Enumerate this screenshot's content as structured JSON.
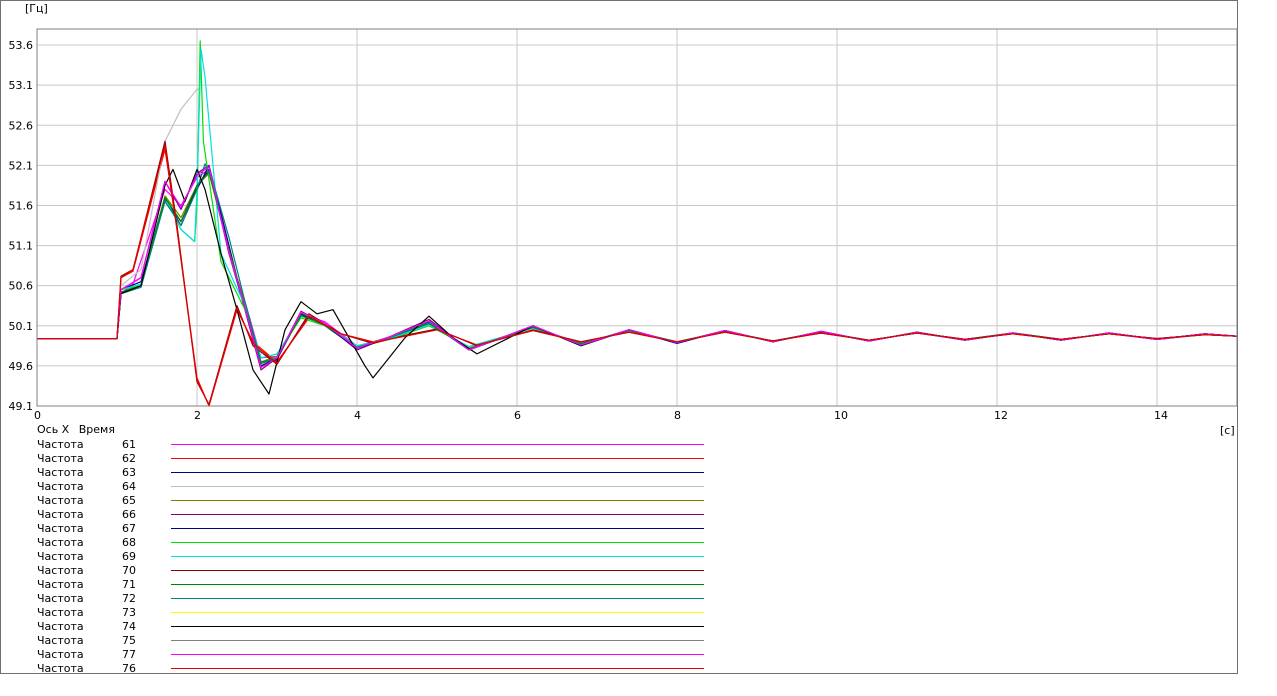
{
  "chart_data": {
    "type": "line",
    "ylabel": "[Гц]",
    "xlabel": "[с]",
    "xlim": [
      0,
      15
    ],
    "ylim": [
      49.1,
      53.8
    ],
    "xticks": [
      0,
      2,
      4,
      6,
      8,
      10,
      12,
      14
    ],
    "xtick_labels": [
      "0",
      "2",
      "4",
      "6",
      "8",
      "10",
      "12",
      "14"
    ],
    "yticks": [
      49.1,
      49.6,
      50.1,
      50.6,
      51.1,
      51.6,
      52.1,
      52.6,
      53.1,
      53.6
    ],
    "ytick_labels": [
      "49.1",
      "49.6",
      "50.1",
      "50.6",
      "51.1",
      "51.6",
      "52.1",
      "52.6",
      "53.1",
      "53.6"
    ],
    "grid": true,
    "legend_position": "bottom-left",
    "legend_header": [
      "Ось X",
      "Время"
    ],
    "series": [
      {
        "name": "Частота",
        "id": "61",
        "color": "#ff00ff",
        "x": [
          0,
          1,
          1.05,
          1.2,
          1.6,
          1.8,
          2.0,
          2.15,
          2.4,
          2.6,
          2.8,
          3.0,
          3.3,
          3.6,
          4.0,
          4.4,
          4.9,
          5.4,
          6.2,
          6.8,
          7.4,
          8.0,
          8.6,
          9.2,
          9.8,
          10.4,
          11.0,
          11.6,
          12.2,
          12.8,
          13.4,
          14.0,
          14.6,
          15
        ],
        "y": [
          49.94,
          49.94,
          50.5,
          50.62,
          51.8,
          51.6,
          51.95,
          52.05,
          51.0,
          50.4,
          49.7,
          49.72,
          50.25,
          50.15,
          49.85,
          49.95,
          50.12,
          49.82,
          50.08,
          49.88,
          50.04,
          49.9,
          50.03,
          49.91,
          50.02,
          49.92,
          50.01,
          49.92,
          50.01,
          49.93,
          50.0,
          49.93,
          49.99,
          49.97
        ]
      },
      {
        "name": "Частота",
        "id": "62",
        "color": "#ff0000",
        "x": [
          0,
          1,
          1.05,
          1.2,
          1.6,
          1.75,
          2.0,
          2.15,
          2.5,
          2.7,
          3.0,
          3.4,
          3.8,
          4.2,
          4.6,
          5.0,
          5.5,
          6.2,
          6.8,
          7.4,
          8.0,
          8.6,
          9.2,
          9.8,
          10.4,
          11.0,
          11.6,
          12.2,
          12.8,
          13.4,
          14.0,
          14.6,
          15
        ],
        "y": [
          49.94,
          49.94,
          50.7,
          50.78,
          52.3,
          51.3,
          49.45,
          49.1,
          50.3,
          49.9,
          49.65,
          50.2,
          50.0,
          49.9,
          49.97,
          50.05,
          49.86,
          50.04,
          49.9,
          50.02,
          49.9,
          50.02,
          49.91,
          50.01,
          49.92,
          50.01,
          49.93,
          50.0,
          49.93,
          50.0,
          49.94,
          49.99,
          49.97
        ]
      },
      {
        "name": "Частота",
        "id": "63",
        "color": "#00008b",
        "x": [
          0,
          1,
          1.05,
          1.3,
          1.6,
          1.8,
          2.0,
          2.15,
          2.4,
          2.6,
          2.8,
          3.0,
          3.3,
          3.6,
          4.0,
          4.4,
          4.9,
          5.4,
          6.2,
          6.8,
          7.4,
          8.0,
          8.6,
          9.2,
          9.8,
          10.4,
          11.0,
          11.6,
          12.2,
          12.8,
          13.4,
          14.0,
          14.6,
          15
        ],
        "y": [
          49.94,
          49.94,
          50.55,
          50.65,
          51.7,
          51.35,
          51.8,
          52.1,
          51.1,
          50.3,
          49.6,
          49.7,
          50.25,
          50.1,
          49.82,
          49.95,
          50.15,
          49.8,
          50.1,
          49.86,
          50.05,
          49.88,
          50.04,
          49.9,
          50.03,
          49.91,
          50.02,
          49.92,
          50.01,
          49.92,
          50.01,
          49.93,
          50.0,
          49.97
        ]
      },
      {
        "name": "Частота",
        "id": "64",
        "color": "#c0c0c0",
        "x": [
          0,
          1,
          1.05,
          1.3,
          1.6,
          1.8,
          2.0,
          2.03
        ],
        "y": [
          49.94,
          49.94,
          50.6,
          50.8,
          52.4,
          52.8,
          53.05,
          53.05
        ]
      },
      {
        "name": "Частота",
        "id": "65",
        "color": "#808000",
        "x": [
          0,
          1,
          1.05,
          1.3,
          1.6,
          1.8,
          2.0,
          2.15,
          2.4,
          2.6,
          2.8,
          3.0,
          3.3,
          3.6,
          4.0,
          4.4,
          4.9,
          5.4,
          6.2,
          6.8,
          7.4,
          8.0,
          8.6,
          9.2,
          9.8,
          10.4,
          11.0,
          11.6,
          12.2,
          12.8,
          13.4,
          14.0,
          14.6,
          15
        ],
        "y": [
          49.94,
          49.94,
          50.52,
          50.6,
          51.72,
          51.45,
          51.85,
          52.0,
          51.05,
          50.35,
          49.65,
          49.72,
          50.22,
          50.12,
          49.84,
          49.96,
          50.12,
          49.82,
          50.08,
          49.88,
          50.04,
          49.9,
          50.03,
          49.91,
          50.02,
          49.92,
          50.01,
          49.93,
          50.01,
          49.93,
          50.0,
          49.94,
          49.99,
          49.97
        ]
      },
      {
        "name": "Частота",
        "id": "66",
        "color": "#800080",
        "x": [
          0,
          1,
          1.05,
          1.3,
          1.6,
          1.8,
          2.0,
          2.15,
          2.4,
          2.6,
          2.8,
          3.0,
          3.3,
          3.6,
          4.0,
          4.4,
          4.9,
          5.4,
          6.2,
          6.8,
          7.4,
          8.0,
          8.6,
          9.2,
          9.8,
          10.4,
          11.0,
          11.6,
          12.2,
          12.8,
          13.4,
          14.0,
          14.6,
          15
        ],
        "y": [
          49.94,
          49.94,
          50.55,
          50.7,
          51.9,
          51.55,
          52.0,
          52.1,
          51.0,
          50.3,
          49.55,
          49.7,
          50.28,
          50.12,
          49.8,
          49.96,
          50.18,
          49.8,
          50.1,
          49.86,
          50.05,
          49.89,
          50.04,
          49.9,
          50.03,
          49.91,
          50.02,
          49.92,
          50.01,
          49.92,
          50.01,
          49.93,
          50.0,
          49.97
        ]
      },
      {
        "name": "Частота",
        "id": "67",
        "color": "#000080",
        "x": [
          0,
          1,
          1.05,
          1.3,
          1.6,
          1.8,
          2.0,
          2.15,
          2.4,
          2.6,
          2.8,
          3.0,
          3.3,
          3.6,
          4.0,
          4.4,
          4.9,
          5.4,
          6.2,
          6.8,
          7.4,
          8.0,
          8.6,
          9.2,
          9.8,
          10.4,
          11.0,
          11.6,
          12.2,
          12.8,
          13.4,
          14.0,
          14.6,
          15
        ],
        "y": [
          49.94,
          49.94,
          50.5,
          50.6,
          51.68,
          51.4,
          51.82,
          52.05,
          51.05,
          50.3,
          49.6,
          49.68,
          50.25,
          50.1,
          49.82,
          49.94,
          50.14,
          49.8,
          50.09,
          49.87,
          50.05,
          49.89,
          50.04,
          49.9,
          50.03,
          49.91,
          50.02,
          49.92,
          50.01,
          49.92,
          50.01,
          49.93,
          50.0,
          49.97
        ]
      },
      {
        "name": "Частота",
        "id": "68",
        "color": "#00e000",
        "x": [
          0,
          1,
          1.05,
          1.3,
          1.6,
          1.8,
          1.97,
          2.0,
          2.04,
          2.08,
          2.3,
          2.6,
          2.8,
          3.0,
          3.3,
          3.6,
          4.0,
          4.4,
          4.9,
          5.4,
          6.2,
          6.8,
          7.4,
          8.0,
          8.6,
          9.2,
          9.8,
          10.4,
          11.0,
          11.6,
          12.2,
          12.8,
          13.4,
          14.0,
          14.6,
          15
        ],
        "y": [
          49.94,
          49.94,
          50.55,
          50.6,
          51.7,
          51.3,
          51.15,
          51.6,
          53.65,
          52.4,
          50.9,
          50.3,
          49.7,
          49.75,
          50.2,
          50.1,
          49.85,
          49.93,
          50.1,
          49.84,
          50.07,
          49.88,
          50.04,
          49.9,
          50.03,
          49.91,
          50.02,
          49.92,
          50.01,
          49.93,
          50.01,
          49.93,
          50.0,
          49.94,
          49.99,
          49.97
        ]
      },
      {
        "name": "Частота",
        "id": "69",
        "color": "#00e0e0",
        "x": [
          0,
          1,
          1.05,
          1.3,
          1.6,
          1.8,
          1.97,
          2.0,
          2.05,
          2.1,
          2.3,
          2.6,
          2.8,
          3.0,
          3.3,
          3.6,
          4.0,
          4.4,
          4.9,
          5.4,
          6.2,
          6.8,
          7.4,
          8.0,
          8.6,
          9.2,
          9.8,
          10.4,
          11.0,
          11.6,
          12.2,
          12.8,
          13.4,
          14.0,
          14.6,
          15
        ],
        "y": [
          49.94,
          49.94,
          50.55,
          50.62,
          51.7,
          51.3,
          51.15,
          51.8,
          53.55,
          53.2,
          51.0,
          50.35,
          49.7,
          49.75,
          50.22,
          50.12,
          49.85,
          49.94,
          50.11,
          49.84,
          50.07,
          49.88,
          50.04,
          49.9,
          50.03,
          49.91,
          50.02,
          49.92,
          50.01,
          49.93,
          50.01,
          49.93,
          50.0,
          49.94,
          49.99,
          49.97
        ]
      },
      {
        "name": "Частота",
        "id": "70",
        "color": "#8b0000",
        "x": [
          0,
          1,
          1.05,
          1.2,
          1.6,
          1.75,
          2.0,
          2.15,
          2.5,
          2.7,
          3.0,
          3.4,
          3.8,
          4.2,
          4.6,
          5.0,
          5.5,
          6.2,
          6.8,
          7.4,
          8.0,
          8.6,
          9.2,
          9.8,
          10.4,
          11.0,
          11.6,
          12.2,
          12.8,
          13.4,
          14.0,
          14.6,
          15
        ],
        "y": [
          49.94,
          49.94,
          50.72,
          50.8,
          52.4,
          51.35,
          49.4,
          49.12,
          50.35,
          49.85,
          49.62,
          50.25,
          50.0,
          49.88,
          49.98,
          50.06,
          49.85,
          50.05,
          49.9,
          50.02,
          49.9,
          50.02,
          49.91,
          50.01,
          49.92,
          50.01,
          49.93,
          50.0,
          49.93,
          50.0,
          49.94,
          49.99,
          49.97
        ]
      },
      {
        "name": "Частота",
        "id": "71",
        "color": "#008000",
        "x": [
          0,
          1,
          1.05,
          1.3,
          1.6,
          1.8,
          2.0,
          2.15,
          2.4,
          2.6,
          2.8,
          3.0,
          3.3,
          3.6,
          4.0,
          4.4,
          4.9,
          5.4,
          6.2,
          6.8,
          7.4,
          8.0,
          8.6,
          9.2,
          9.8,
          10.4,
          11.0,
          11.6,
          12.2,
          12.8,
          13.4,
          14.0,
          14.6,
          15
        ],
        "y": [
          49.94,
          49.94,
          50.52,
          50.6,
          51.7,
          51.4,
          51.85,
          52.02,
          51.05,
          50.33,
          49.63,
          49.7,
          50.23,
          50.11,
          49.83,
          49.95,
          50.13,
          49.81,
          50.08,
          49.88,
          50.04,
          49.9,
          50.03,
          49.91,
          50.02,
          49.92,
          50.01,
          49.93,
          50.01,
          49.93,
          50.0,
          49.94,
          49.99,
          49.97
        ]
      },
      {
        "name": "Частота",
        "id": "72",
        "color": "#008080",
        "x": [
          0,
          1,
          1.05,
          1.3,
          1.6,
          1.8,
          2.0,
          2.1,
          2.2,
          2.4,
          2.6,
          2.8,
          3.0,
          3.3,
          3.6,
          4.0,
          4.4,
          4.9,
          5.4,
          6.2,
          6.8,
          7.4,
          8.0,
          8.6,
          9.2,
          9.8,
          10.4,
          11.0,
          11.6,
          12.2,
          12.8,
          13.4,
          14.0,
          14.6,
          15
        ],
        "y": [
          49.94,
          49.94,
          50.5,
          50.58,
          51.65,
          51.35,
          51.8,
          52.12,
          51.9,
          51.2,
          50.4,
          49.65,
          49.7,
          50.26,
          50.12,
          49.83,
          49.95,
          50.14,
          49.81,
          50.09,
          49.87,
          50.05,
          49.89,
          50.04,
          49.9,
          50.03,
          49.91,
          50.02,
          49.92,
          50.01,
          49.92,
          50.01,
          49.93,
          50.0,
          49.97
        ]
      },
      {
        "name": "Частота",
        "id": "73",
        "color": "#ffff00",
        "x": [],
        "y": []
      },
      {
        "name": "Частота",
        "id": "74",
        "color": "#000000",
        "x": [
          0,
          1,
          1.05,
          1.3,
          1.6,
          1.7,
          1.85,
          2.0,
          2.1,
          2.3,
          2.5,
          2.7,
          2.9,
          3.1,
          3.3,
          3.5,
          3.7,
          3.9,
          4.1,
          4.2,
          4.4,
          4.6,
          4.9,
          5.2,
          5.5,
          6.2,
          6.8,
          7.4,
          8.0,
          8.6,
          9.2,
          9.8,
          10.4,
          11.0,
          11.6,
          12.2,
          12.8,
          13.4,
          14.0,
          14.6,
          15
        ],
        "y": [
          49.94,
          49.94,
          50.5,
          50.6,
          51.85,
          52.05,
          51.65,
          52.05,
          51.8,
          51.0,
          50.3,
          49.55,
          49.25,
          50.05,
          50.4,
          50.25,
          50.3,
          49.95,
          49.6,
          49.45,
          49.7,
          49.95,
          50.22,
          49.95,
          49.75,
          50.1,
          49.85,
          50.05,
          49.89,
          50.04,
          49.9,
          50.03,
          49.91,
          50.02,
          49.92,
          50.01,
          49.92,
          50.01,
          49.93,
          50.0,
          49.97
        ]
      },
      {
        "name": "Частота",
        "id": "75",
        "color": "#808080",
        "x": [],
        "y": []
      },
      {
        "name": "Частота",
        "id": "77",
        "color": "#ff00ff",
        "x": [
          0,
          1,
          1.05,
          1.3,
          1.6,
          1.8,
          2.0,
          2.15,
          2.4,
          2.6,
          2.8,
          3.0,
          3.3,
          3.6,
          4.0,
          4.4,
          4.9,
          5.4,
          6.2,
          6.8,
          7.4,
          8.0,
          8.6,
          9.2,
          9.8,
          10.4,
          11.0,
          11.6,
          12.2,
          12.8,
          13.4,
          14.0,
          14.6,
          15
        ],
        "y": [
          49.94,
          49.94,
          50.55,
          50.7,
          51.9,
          51.58,
          51.98,
          52.08,
          51.02,
          50.32,
          49.58,
          49.7,
          50.27,
          50.13,
          49.82,
          49.96,
          50.16,
          49.8,
          50.1,
          49.86,
          50.05,
          49.89,
          50.04,
          49.9,
          50.03,
          49.91,
          50.02,
          49.92,
          50.01,
          49.92,
          50.01,
          49.93,
          50.0,
          49.97
        ]
      },
      {
        "name": "Частота",
        "id": "76",
        "color": "#e00000",
        "x": [
          0,
          1,
          1.05,
          1.2,
          1.6,
          1.75,
          2.0,
          2.15,
          2.5,
          2.7,
          3.0,
          3.4,
          3.8,
          4.2,
          4.6,
          5.0,
          5.5,
          6.2,
          6.8,
          7.4,
          8.0,
          8.6,
          9.2,
          9.8,
          10.4,
          11.0,
          11.6,
          12.2,
          12.8,
          13.4,
          14.0,
          14.6,
          15
        ],
        "y": [
          49.94,
          49.94,
          50.7,
          50.8,
          52.35,
          51.3,
          49.42,
          49.11,
          50.32,
          49.88,
          49.63,
          50.22,
          50.0,
          49.89,
          49.97,
          50.05,
          49.86,
          50.04,
          49.9,
          50.02,
          49.9,
          50.02,
          49.91,
          50.01,
          49.92,
          50.01,
          49.93,
          50.0,
          49.93,
          50.0,
          49.94,
          49.99,
          49.97
        ]
      }
    ]
  }
}
